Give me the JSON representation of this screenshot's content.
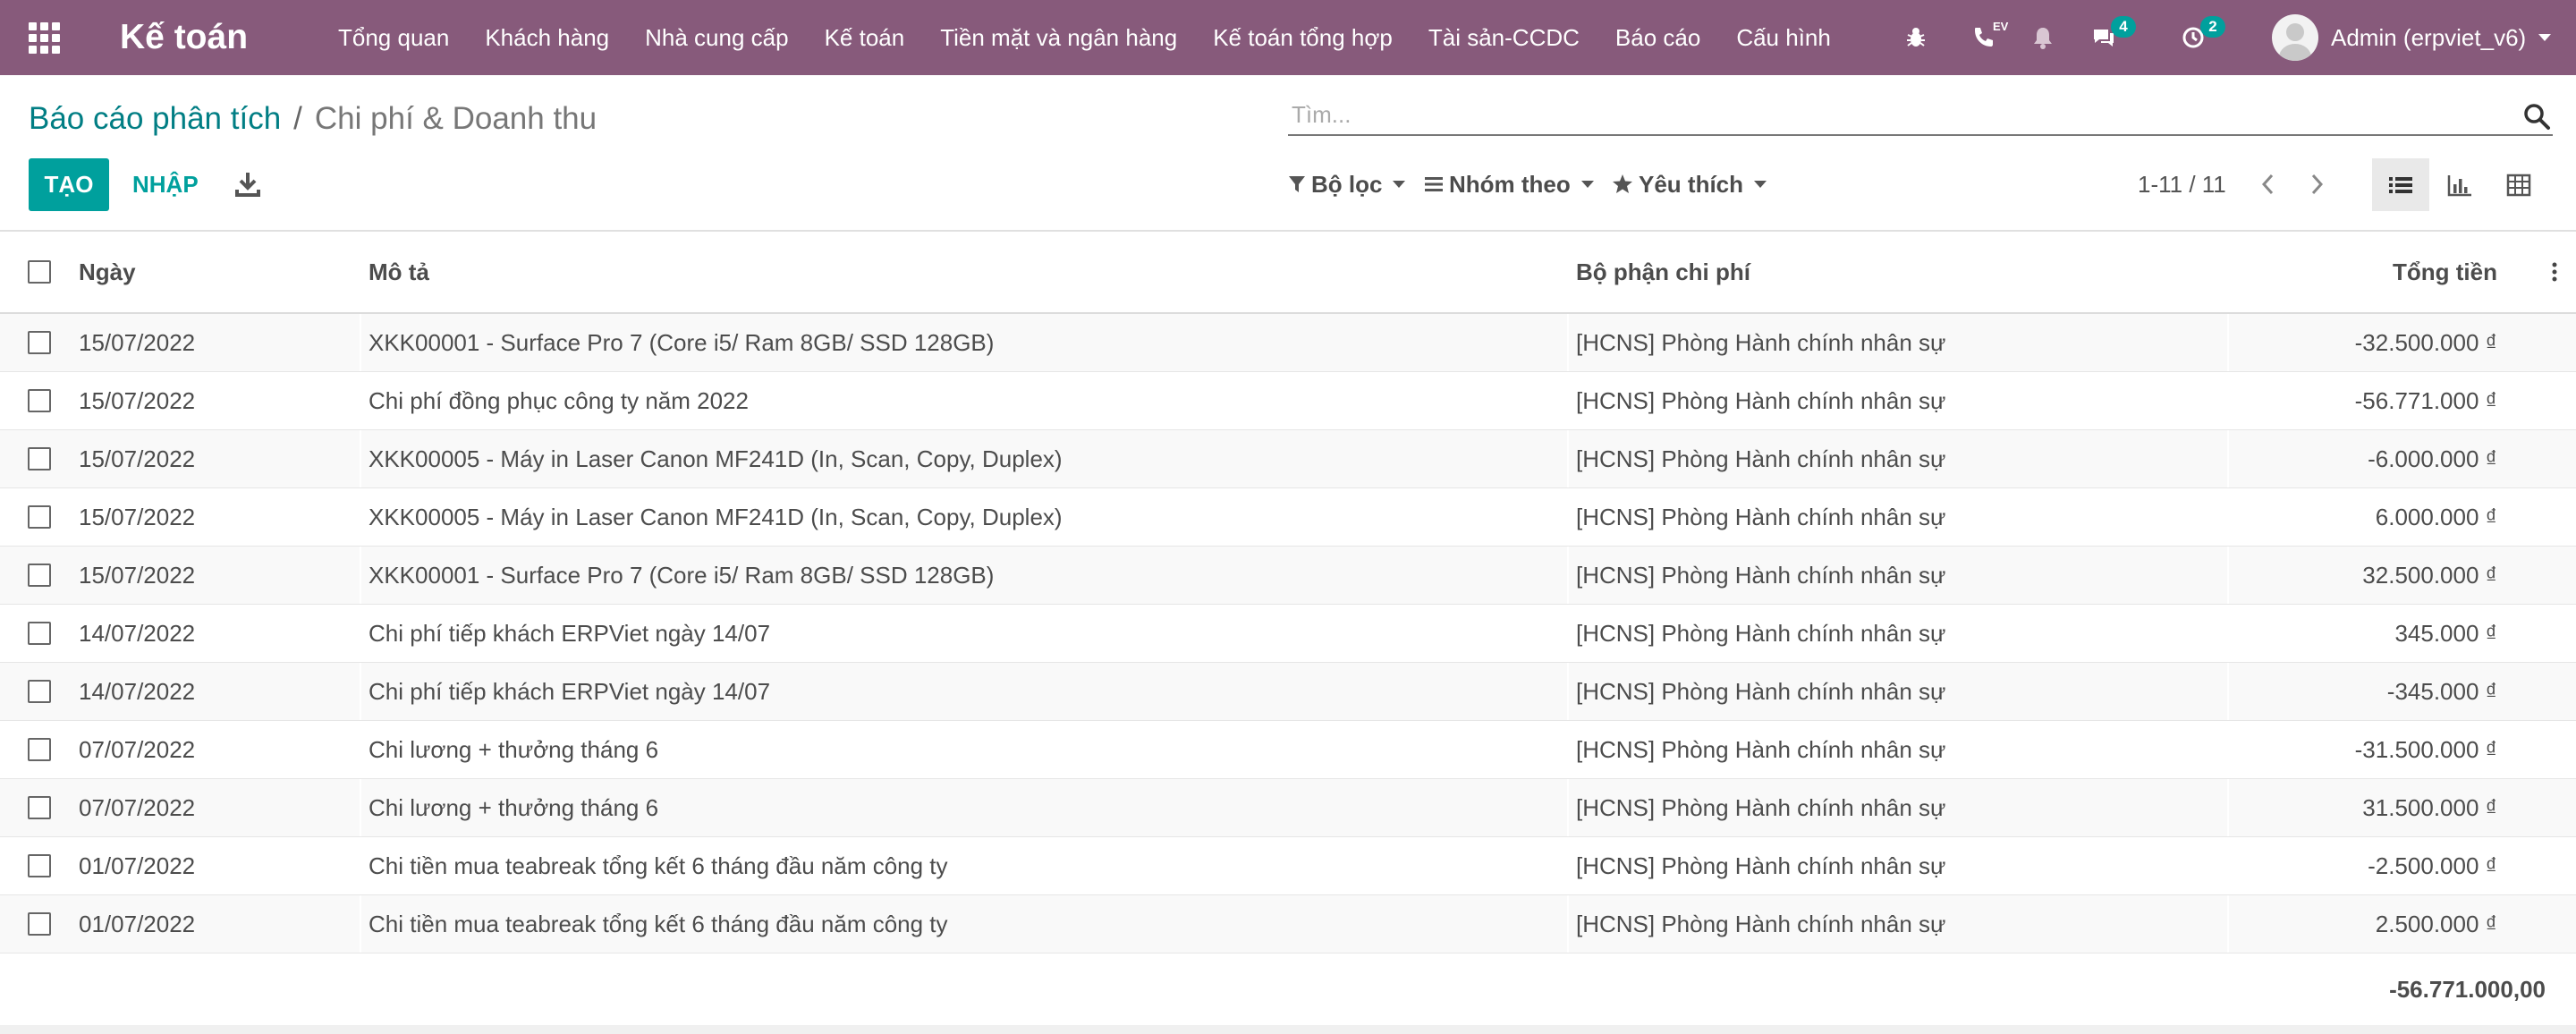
{
  "navbar": {
    "app_title": "Kế toán",
    "menu": [
      "Tổng quan",
      "Khách hàng",
      "Nhà cung cấp",
      "Kế toán",
      "Tiền mặt và ngân hàng",
      "Kế toán tổng hợp",
      "Tài sản-CCDC",
      "Báo cáo",
      "Cấu hình"
    ],
    "voip_label": "EV",
    "messages_count": "4",
    "activities_count": "2",
    "user_name": "Admin (erpviet_v6)",
    "colors": {
      "navbar": "#875a7b",
      "badge": "#00a09d"
    },
    "icons": [
      "apps-grid-icon",
      "bug-icon",
      "phone-icon",
      "bell-icon",
      "chat-icon",
      "clock-icon"
    ]
  },
  "breadcrumb": {
    "parent": "Báo cáo phân tích",
    "separator": "/",
    "current": "Chi phí & Doanh thu"
  },
  "search": {
    "placeholder": "Tìm...",
    "value": ""
  },
  "toolbar": {
    "create_label": "TẠO",
    "import_label": "NHẬP",
    "filter_label": "Bộ lọc",
    "groupby_label": "Nhóm theo",
    "favorites_label": "Yêu thích",
    "pager_value": "1-11 / 11",
    "views": [
      "list",
      "graph",
      "pivot"
    ],
    "active_view": "list",
    "accent_color": "#00a09d"
  },
  "table": {
    "columns": [
      "Ngày",
      "Mô tả",
      "Bộ phận chi phí",
      "Tổng tiền"
    ],
    "rows": [
      {
        "date": "15/07/2022",
        "description": "XKK00001 - Surface Pro 7 (Core i5/ Ram 8GB/ SSD 128GB)",
        "department": "[HCNS] Phòng Hành chính nhân sự",
        "amount": "-32.500.000 ₫"
      },
      {
        "date": "15/07/2022",
        "description": "Chi phí đồng phục công ty năm 2022",
        "department": "[HCNS] Phòng Hành chính nhân sự",
        "amount": "-56.771.000 ₫"
      },
      {
        "date": "15/07/2022",
        "description": "XKK00005 - Máy in Laser Canon MF241D (In, Scan, Copy, Duplex)",
        "department": "[HCNS] Phòng Hành chính nhân sự",
        "amount": "-6.000.000 ₫"
      },
      {
        "date": "15/07/2022",
        "description": "XKK00005 - Máy in Laser Canon MF241D (In, Scan, Copy, Duplex)",
        "department": "[HCNS] Phòng Hành chính nhân sự",
        "amount": "6.000.000 ₫"
      },
      {
        "date": "15/07/2022",
        "description": "XKK00001 - Surface Pro 7 (Core i5/ Ram 8GB/ SSD 128GB)",
        "department": "[HCNS] Phòng Hành chính nhân sự",
        "amount": "32.500.000 ₫"
      },
      {
        "date": "14/07/2022",
        "description": "Chi phí tiếp khách ERPViet ngày 14/07",
        "department": "[HCNS] Phòng Hành chính nhân sự",
        "amount": "345.000 ₫"
      },
      {
        "date": "14/07/2022",
        "description": "Chi phí tiếp khách ERPViet ngày 14/07",
        "department": "[HCNS] Phòng Hành chính nhân sự",
        "amount": "-345.000 ₫"
      },
      {
        "date": "07/07/2022",
        "description": "Chi lương + thưởng tháng 6",
        "department": "[HCNS] Phòng Hành chính nhân sự",
        "amount": "-31.500.000 ₫"
      },
      {
        "date": "07/07/2022",
        "description": "Chi lương + thưởng tháng 6",
        "department": "[HCNS] Phòng Hành chính nhân sự",
        "amount": "31.500.000 ₫"
      },
      {
        "date": "01/07/2022",
        "description": "Chi tiền mua teabreak tổng kết 6 tháng đầu năm công ty",
        "department": "[HCNS] Phòng Hành chính nhân sự",
        "amount": "-2.500.000 ₫"
      },
      {
        "date": "01/07/2022",
        "description": "Chi tiền mua teabreak tổng kết 6 tháng đầu năm công ty",
        "department": "[HCNS] Phòng Hành chính nhân sự",
        "amount": "2.500.000 ₫"
      }
    ],
    "total": "-56.771.000,00"
  }
}
